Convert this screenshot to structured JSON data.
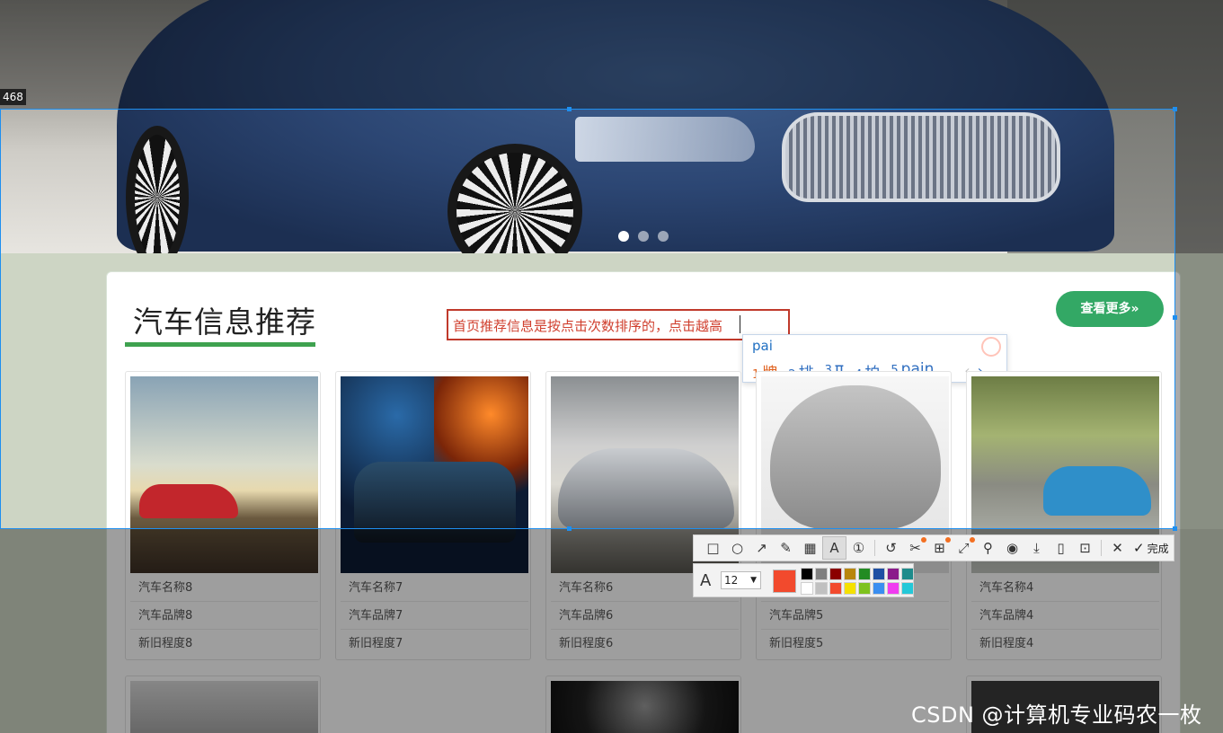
{
  "screenshot": {
    "size_label": "468"
  },
  "banner": {
    "dots": [
      true,
      false,
      false
    ]
  },
  "section": {
    "title": "汽车信息推荐",
    "more_button": "查看更多»",
    "note": "首页推荐信息是按点击次数排序的，点击越高"
  },
  "ime": {
    "input": "pai",
    "candidates": [
      {
        "num": "1",
        "text": "牌"
      },
      {
        "num": "2",
        "text": "排"
      },
      {
        "num": "3",
        "text": "π"
      },
      {
        "num": "4",
        "text": "拍"
      },
      {
        "num": "5",
        "text": "pain"
      }
    ],
    "prev": "‹",
    "next": "›"
  },
  "cars": [
    {
      "name": "汽车名称8",
      "brand": "汽车品牌8",
      "condition": "新旧程度8"
    },
    {
      "name": "汽车名称7",
      "brand": "汽车品牌7",
      "condition": "新旧程度7"
    },
    {
      "name": "汽车名称6",
      "brand": "汽车品牌6",
      "condition": "新旧程度6"
    },
    {
      "name": "",
      "brand": "汽车品牌5",
      "condition": "新旧程度5"
    },
    {
      "name": "汽车名称4",
      "brand": "汽车品牌4",
      "condition": "新旧程度4"
    }
  ],
  "toolbar": {
    "tools": [
      "rectangle-icon",
      "ellipse-icon",
      "arrow-icon",
      "pencil-icon",
      "mosaic-icon",
      "text-icon",
      "number-icon",
      "undo-icon",
      "scissors-icon",
      "translate-icon",
      "scan-icon",
      "pin-icon",
      "record-icon",
      "download-icon",
      "save-icon",
      "bookmark-icon",
      "close-icon"
    ],
    "done_label": "完成"
  },
  "text_options": {
    "font_size": "12",
    "current_color": "#f24a2d",
    "palette": [
      "#000000",
      "#808080",
      "#8b0000",
      "#b8860b",
      "#228b22",
      "#1e4fa3",
      "#8b1a8b",
      "#1e8b8b",
      "#ffffff",
      "#c0c0c0",
      "#f24a2d",
      "#f5e100",
      "#7ec21e",
      "#3a8ef0",
      "#f03cf0",
      "#24c8d8"
    ]
  },
  "watermark": "CSDN @计算机专业码农一枚"
}
